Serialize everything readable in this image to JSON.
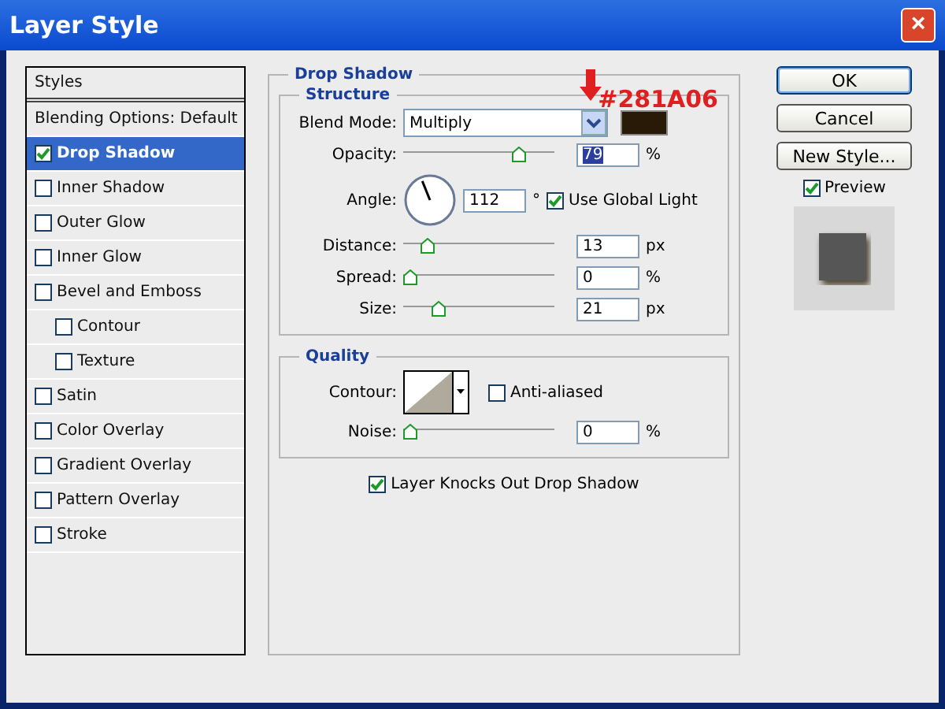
{
  "window": {
    "title": "Layer Style",
    "close": "×"
  },
  "styles": {
    "header": "Styles",
    "items": [
      {
        "label": "Blending Options: Default",
        "kind": "plain",
        "selected": false
      },
      {
        "label": "Drop Shadow",
        "kind": "check",
        "checked": true,
        "selected": true
      },
      {
        "label": "Inner Shadow",
        "kind": "check",
        "checked": false,
        "selected": false
      },
      {
        "label": "Outer Glow",
        "kind": "check",
        "checked": false,
        "selected": false
      },
      {
        "label": "Inner Glow",
        "kind": "check",
        "checked": false,
        "selected": false
      },
      {
        "label": "Bevel and Emboss",
        "kind": "check",
        "checked": false,
        "selected": false,
        "children": [
          {
            "label": "Contour",
            "kind": "check",
            "checked": false,
            "selected": false
          },
          {
            "label": "Texture",
            "kind": "check",
            "checked": false,
            "selected": false
          }
        ]
      },
      {
        "label": "Satin",
        "kind": "check",
        "checked": false,
        "selected": false
      },
      {
        "label": "Color Overlay",
        "kind": "check",
        "checked": false,
        "selected": false
      },
      {
        "label": "Gradient Overlay",
        "kind": "check",
        "checked": false,
        "selected": false
      },
      {
        "label": "Pattern Overlay",
        "kind": "check",
        "checked": false,
        "selected": false
      },
      {
        "label": "Stroke",
        "kind": "check",
        "checked": false,
        "selected": false
      }
    ]
  },
  "panel": {
    "title": "Drop Shadow",
    "structure": {
      "title": "Structure",
      "blend_mode": {
        "label": "Blend Mode:",
        "value": "Multiply",
        "color": "#281a06"
      },
      "annotation": "#281A06",
      "opacity": {
        "label": "Opacity:",
        "level": 0.79,
        "value": "79",
        "unit": "%"
      },
      "angle": {
        "label": "Angle:",
        "value": "112",
        "unit": "°",
        "global_light": {
          "label": "Use Global Light",
          "checked": true
        }
      },
      "sliders": [
        {
          "label": "Distance:",
          "level": 0.13,
          "value": "13",
          "unit": "px"
        },
        {
          "label": "Spread:",
          "level": 0,
          "value": "0",
          "unit": "%"
        },
        {
          "label": "Size:",
          "level": 0.21,
          "value": "21",
          "unit": "px"
        }
      ]
    },
    "quality": {
      "title": "Quality",
      "contour": {
        "label": "Contour:"
      },
      "anti_aliased": {
        "label": "Anti-aliased",
        "checked": false
      },
      "noise": {
        "label": "Noise:",
        "level": 0,
        "value": "0",
        "unit": "%"
      }
    },
    "knockout": {
      "label": "Layer Knocks Out Drop Shadow",
      "checked": true
    }
  },
  "buttons": [
    {
      "label": "OK",
      "kind": "default"
    },
    {
      "label": "Cancel",
      "kind": "normal"
    },
    {
      "label": "New Style...",
      "kind": "normal"
    }
  ],
  "preview": {
    "label": "Preview",
    "checked": true
  }
}
